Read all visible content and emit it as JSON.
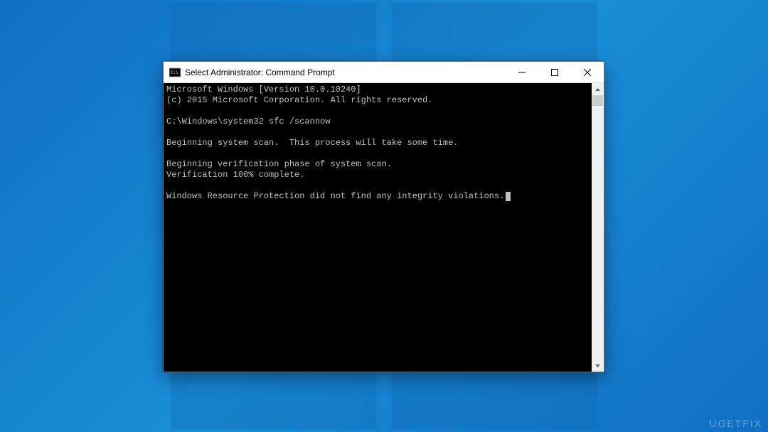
{
  "window": {
    "title": "Select Administrator: Command Prompt",
    "controls": {
      "minimize": "minimize",
      "maximize": "maximize",
      "close": "close"
    }
  },
  "console": {
    "lines": [
      "Microsoft Windows [Version 10.0.10240]",
      "(c) 2015 Microsoft Corporation. All rights reserved.",
      "",
      "C:\\Windows\\system32 sfc /scannow",
      "",
      "Beginning system scan.  This process will take some time.",
      "",
      "Beginning verification phase of system scan.",
      "Verification 100% complete.",
      "",
      "Windows Resource Protection did not find any integrity violations."
    ]
  },
  "watermark": "UGETFIX"
}
